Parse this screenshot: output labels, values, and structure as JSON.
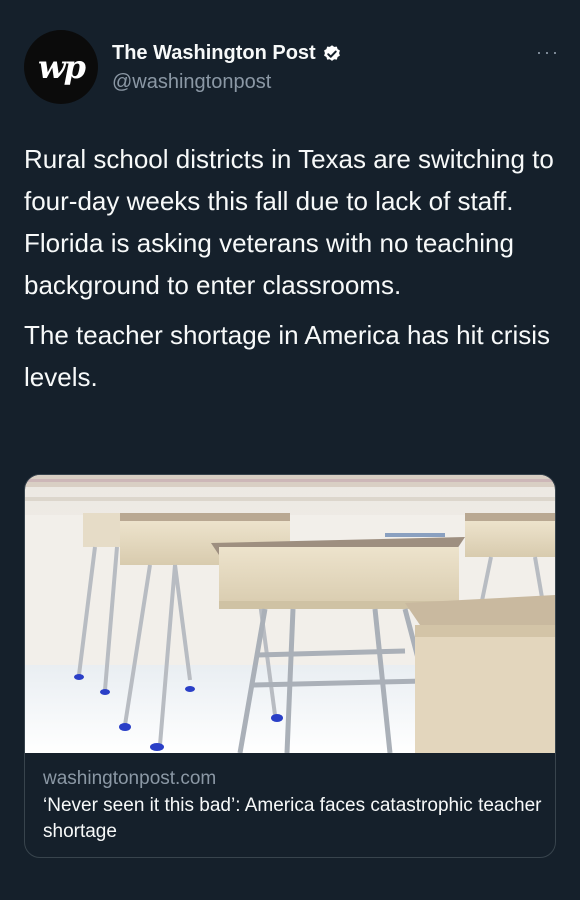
{
  "account": {
    "avatar_text": "wp",
    "display_name": "The Washington Post",
    "handle": "@washingtonpost",
    "verified": true
  },
  "menu": {
    "more_glyph": "···"
  },
  "tweet": {
    "paragraph_1": "Rural school districts in Texas are switching to four-day weeks this fall due to lack of staff. Florida is asking veterans with no teaching background to enter classrooms.",
    "paragraph_2": "The teacher shortage in America has hit crisis levels."
  },
  "link_card": {
    "domain": "washingtonpost.com",
    "title": "‘Never seen it this bad’: America faces catastrophic teacher shortage"
  },
  "colors": {
    "background": "#15202b",
    "primary_text": "#f7f9f9",
    "secondary_text": "#8b98a5",
    "border": "#38444d",
    "verified": "#ffffff"
  }
}
